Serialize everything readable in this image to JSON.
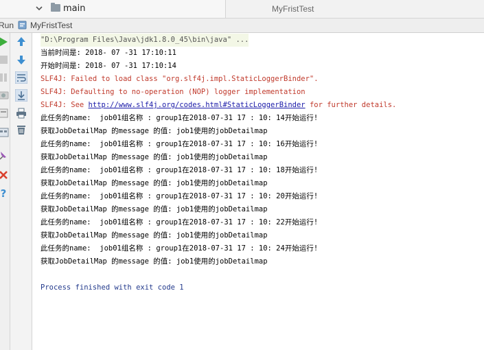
{
  "tabs": {
    "project_item": "main",
    "editor_tab": "MyFristTest"
  },
  "run_panel": {
    "title": "Run",
    "config_name": "MyFristTest"
  },
  "console": {
    "command_line": "\"D:\\Program Files\\Java\\jdk1.8.0_45\\bin\\java\" ...",
    "current_time": "当前时间是: 2018- 07 -31 17:10:11",
    "start_time": "开始时间是: 2018- 07 -31 17:10:14",
    "slf4j_1": "SLF4J: Failed to load class \"org.slf4j.impl.StaticLoggerBinder\".",
    "slf4j_2": "SLF4J: Defaulting to no-operation (NOP) logger implementation",
    "slf4j_3_prefix": "SLF4J: See ",
    "slf4j_3_link": "http://www.slf4j.org/codes.html#StaticLoggerBinder",
    "slf4j_3_suffix": " for further details.",
    "job_lines": [
      "此任务的name:  job01组名称 : group1在2018-07-31 17 : 10: 14开始运行!",
      "获取JobDetailMap 的message 的值: job1使用的jobDetailmap",
      "此任务的name:  job01组名称 : group1在2018-07-31 17 : 10: 16开始运行!",
      "获取JobDetailMap 的message 的值: job1使用的jobDetailmap",
      "此任务的name:  job01组名称 : group1在2018-07-31 17 : 10: 18开始运行!",
      "获取JobDetailMap 的message 的值: job1使用的jobDetailmap",
      "此任务的name:  job01组名称 : group1在2018-07-31 17 : 10: 20开始运行!",
      "获取JobDetailMap 的message 的值: job1使用的jobDetailmap",
      "此任务的name:  job01组名称 : group1在2018-07-31 17 : 10: 22开始运行!",
      "获取JobDetailMap 的message 的值: job1使用的jobDetailmap",
      "此任务的name:  job01组名称 : group1在2018-07-31 17 : 10: 24开始运行!",
      "获取JobDetailMap 的message 的值: job1使用的jobDetailmap"
    ],
    "exit_message": "Process finished with exit code 1"
  },
  "icons": {
    "left_strip": [
      "rerun-icon",
      "stop-icon",
      "pause-icon",
      "dump-threads-icon",
      "restore-layout-icon",
      "settings-icon",
      "pin-icon",
      "close-icon",
      "help-icon"
    ],
    "tool_strip": [
      "scroll-up-icon",
      "scroll-down-icon",
      "soft-wrap-icon",
      "scroll-to-end-icon",
      "print-icon",
      "clear-all-icon"
    ]
  },
  "colors": {
    "error_text": "#c0392b",
    "link": "#1a1aa8",
    "run_green": "#3cae3c",
    "arrow_blue": "#3d8fd1",
    "close_red": "#d9412e",
    "help_blue": "#3d8fd1"
  }
}
